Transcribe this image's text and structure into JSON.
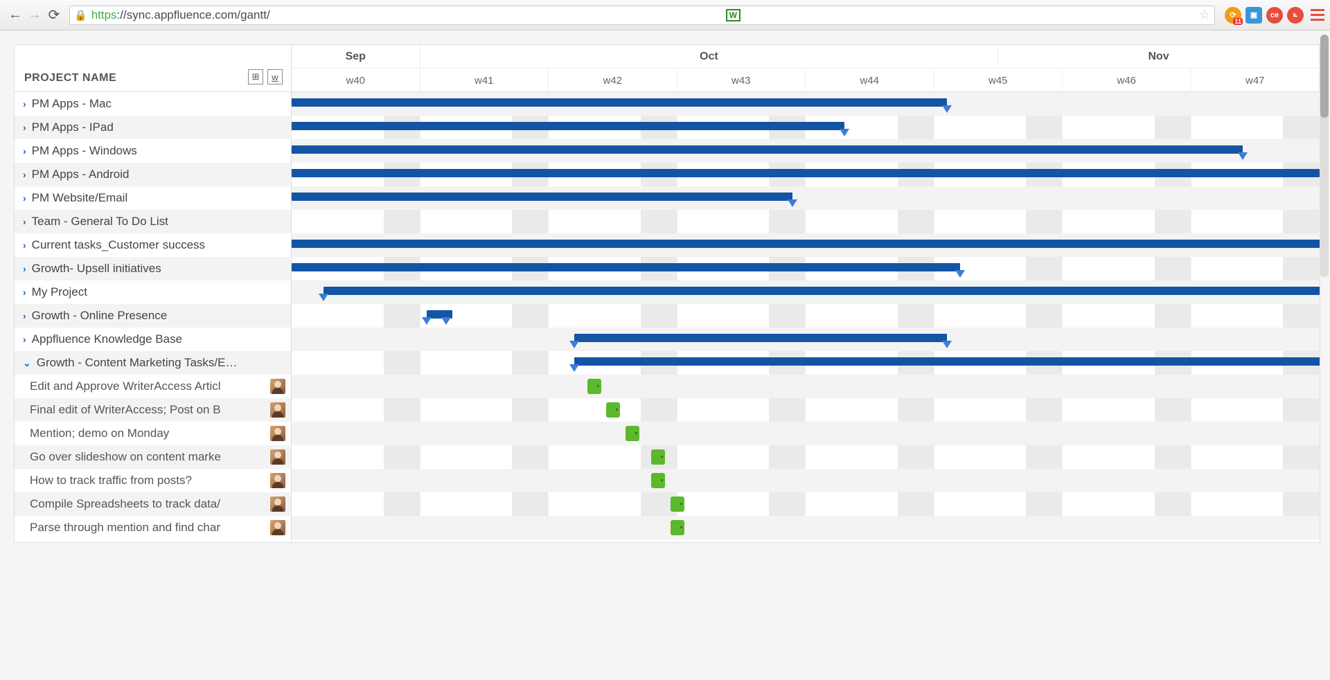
{
  "browser": {
    "url_secure": "https",
    "url_rest": "://sync.appfluence.com/gantt/",
    "ext_badge": "11"
  },
  "sidebar": {
    "header_label": "PROJECT NAME",
    "projects": [
      {
        "label": "PM Apps - Mac",
        "expanded": false
      },
      {
        "label": "PM Apps - IPad",
        "expanded": false
      },
      {
        "label": "PM Apps - Windows",
        "expanded": false
      },
      {
        "label": "PM Apps - Android",
        "expanded": false
      },
      {
        "label": "PM Website/Email",
        "expanded": false
      },
      {
        "label": "Team - General To Do List",
        "expanded": false
      },
      {
        "label": "Current tasks_Customer success",
        "expanded": false
      },
      {
        "label": "Growth- Upsell initiatives",
        "expanded": false
      },
      {
        "label": "My Project",
        "expanded": false
      },
      {
        "label": "Growth - Online Presence",
        "expanded": false
      },
      {
        "label": "Appfluence Knowledge Base",
        "expanded": false
      },
      {
        "label": "Growth - Content Marketing Tasks/E…",
        "expanded": true
      }
    ],
    "tasks": [
      {
        "label": "Edit and Approve WriterAccess Articl"
      },
      {
        "label": "Final edit of WriterAccess; Post on B"
      },
      {
        "label": "Mention; demo on Monday"
      },
      {
        "label": "Go over slideshow on content marke"
      },
      {
        "label": "How to track traffic from posts?"
      },
      {
        "label": "Compile Spreadsheets to track data/"
      },
      {
        "label": "Parse through mention and find char"
      }
    ]
  },
  "timeline": {
    "months": [
      {
        "label": "Sep",
        "weeks": 1
      },
      {
        "label": "Oct",
        "weeks": 4.5
      },
      {
        "label": "Nov",
        "weeks": 2.5
      }
    ],
    "weeks": [
      "w40",
      "w41",
      "w42",
      "w43",
      "w44",
      "w45",
      "w46",
      "w47"
    ]
  },
  "chart_data": {
    "type": "gantt",
    "x_unit": "week",
    "x_range": [
      "w40",
      "w47"
    ],
    "color_project": "#1454a4",
    "color_task": "#5cb82c",
    "bars": [
      {
        "name": "PM Apps - Mac",
        "type": "project",
        "start": 40.0,
        "end": 45.1,
        "markers": [
          45.1
        ]
      },
      {
        "name": "PM Apps - IPad",
        "type": "project",
        "start": 40.0,
        "end": 44.3,
        "markers": [
          44.3
        ]
      },
      {
        "name": "PM Apps - Windows",
        "type": "project",
        "start": 40.0,
        "end": 47.4,
        "markers": [
          47.4
        ]
      },
      {
        "name": "PM Apps - Android",
        "type": "project",
        "start": 40.0,
        "end": 48.0
      },
      {
        "name": "PM Website/Email",
        "type": "project",
        "start": 40.0,
        "end": 43.9,
        "markers": [
          43.9
        ]
      },
      {
        "name": "Team - General To Do List",
        "type": "project",
        "start": null,
        "end": null
      },
      {
        "name": "Current tasks_Customer success",
        "type": "project",
        "start": 40.0,
        "end": 48.0
      },
      {
        "name": "Growth- Upsell initiatives",
        "type": "project",
        "start": 40.0,
        "end": 45.2,
        "markers": [
          45.2
        ]
      },
      {
        "name": "My Project",
        "type": "project",
        "start": 40.25,
        "end": 48.0,
        "markers": [
          40.25
        ]
      },
      {
        "name": "Growth - Online Presence",
        "type": "project",
        "start": 41.05,
        "end": 41.25,
        "markers": [
          41.05,
          41.2
        ]
      },
      {
        "name": "Appfluence Knowledge Base",
        "type": "project",
        "start": 42.2,
        "end": 45.1,
        "markers": [
          42.2,
          45.1
        ]
      },
      {
        "name": "Growth - Content Marketing Tasks/E…",
        "type": "project",
        "start": 42.2,
        "end": 48.0,
        "markers": [
          42.2
        ]
      },
      {
        "name": "Edit and Approve WriterAccess Articl",
        "type": "task",
        "start": 42.3,
        "end": 42.45
      },
      {
        "name": "Final edit of WriterAccess; Post on B",
        "type": "task",
        "start": 42.45,
        "end": 42.6
      },
      {
        "name": "Mention; demo on Monday",
        "type": "task",
        "start": 42.6,
        "end": 42.75
      },
      {
        "name": "Go over slideshow on content marke",
        "type": "task",
        "start": 42.8,
        "end": 42.95
      },
      {
        "name": "How to track traffic from posts?",
        "type": "task",
        "start": 42.8,
        "end": 42.95
      },
      {
        "name": "Compile Spreadsheets to track data/",
        "type": "task",
        "start": 42.95,
        "end": 43.1
      },
      {
        "name": "Parse through mention and find char",
        "type": "task",
        "start": 42.95,
        "end": 43.1
      }
    ]
  }
}
